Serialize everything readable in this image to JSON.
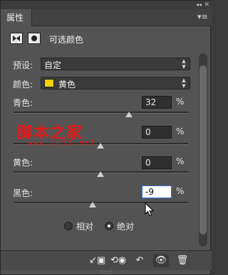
{
  "panel": {
    "tab_label": "属性",
    "header_title": "可选颜色",
    "collapse_icon": "double-chevron-icon",
    "close_icon": "close-icon",
    "menu_icon": "panel-menu-icon"
  },
  "preset": {
    "label": "预设:",
    "value": "自定"
  },
  "colors": {
    "label": "颜色:",
    "value": "黄色",
    "swatch_color": "#f5d000"
  },
  "sliders": [
    {
      "label": "青色:",
      "value": "32",
      "unit": "%",
      "level_percent": 32
    },
    {
      "label": "",
      "value": "0",
      "unit": "%",
      "level_percent": 0
    },
    {
      "label": "黄色:",
      "value": "0",
      "unit": "%",
      "level_percent": 0
    },
    {
      "label": "黑色:",
      "value": "-9",
      "unit": "%",
      "level_percent": -9
    }
  ],
  "watermark": {
    "text": "脚本之家",
    "url": "www.jb51.net",
    "color": "#e21a1a"
  },
  "method": {
    "relative_label": "相对",
    "absolute_label": "绝对",
    "selected": "absolute"
  },
  "bottom_icons": [
    "clip-to-layer-icon",
    "view-previous-state-icon",
    "reset-icon",
    "visibility-eye-icon",
    "trash-icon"
  ]
}
